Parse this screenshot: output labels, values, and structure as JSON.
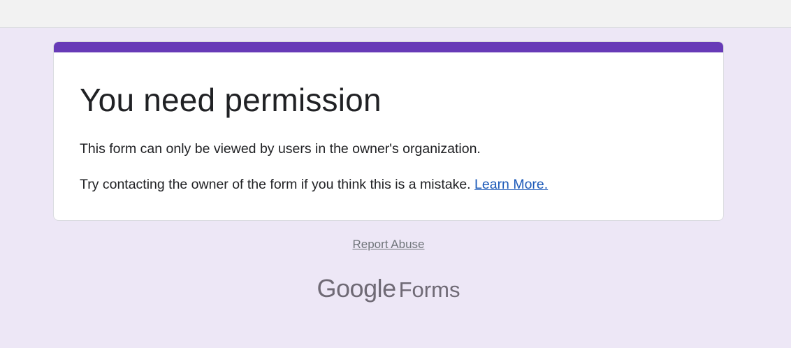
{
  "card": {
    "title": "You need permission",
    "message": "This form can only be viewed by users in the owner's organization.",
    "hint": "Try contacting the owner of the form if you think this is a mistake.",
    "learn_more": "Learn More."
  },
  "footer": {
    "report_abuse": "Report Abuse",
    "brand_google": "Google",
    "brand_forms": "Forms"
  },
  "colors": {
    "background": "#ede7f6",
    "accent": "#673ab7",
    "link": "#1a58b8",
    "text": "#202124",
    "muted": "#70757a"
  }
}
